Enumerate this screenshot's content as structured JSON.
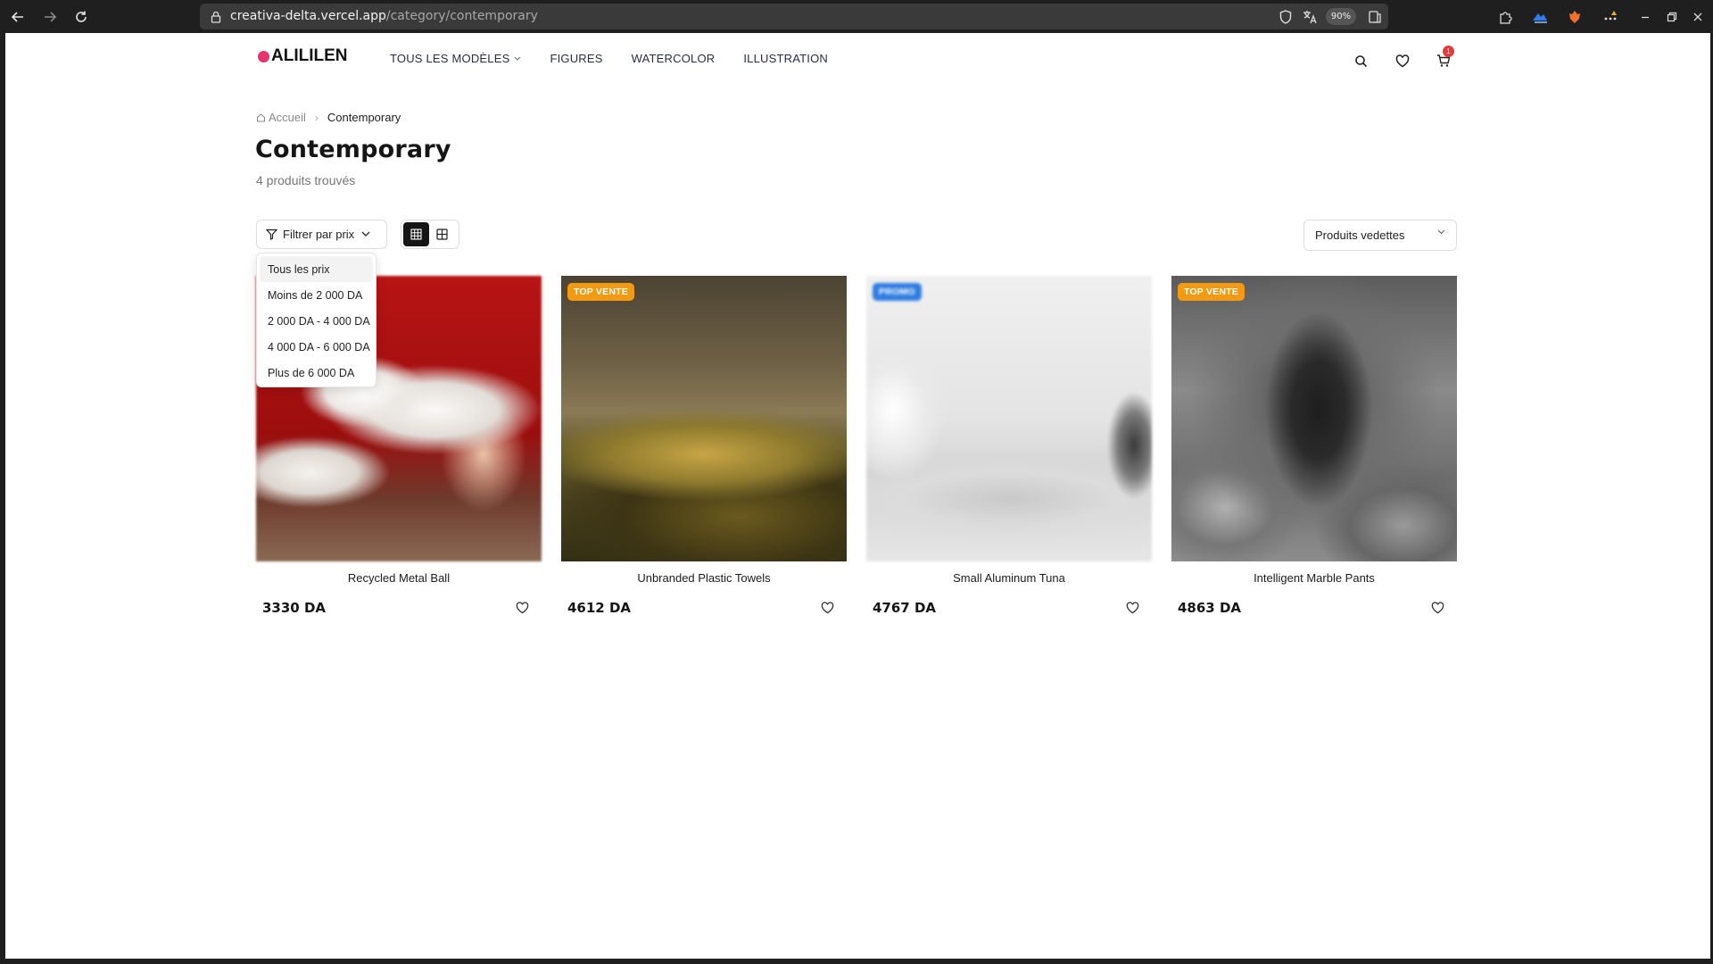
{
  "browser": {
    "url_host": "creativa-delta.vercel.app",
    "url_path": "/category/contemporary",
    "zoom": "90%"
  },
  "header": {
    "logo_text": "ALILILEN",
    "nav": [
      {
        "label": "TOUS LES MODÈLES",
        "has_dropdown": true
      },
      {
        "label": "FIGURES"
      },
      {
        "label": "WATERCOLOR"
      },
      {
        "label": "ILLUSTRATION"
      }
    ],
    "cart_count": "1"
  },
  "breadcrumb": {
    "home": "Accueil",
    "current": "Contemporary"
  },
  "page": {
    "title": "Contemporary",
    "count": "4 produits trouvés"
  },
  "toolbar": {
    "filter_label": "Filtrer par prix",
    "sort_label": "Produits vedettes"
  },
  "price_filter": {
    "options": [
      "Tous les prix",
      "Moins de 2 000 DA",
      "2 000 DA - 4 000 DA",
      "4 000 DA - 6 000 DA",
      "Plus de 6 000 DA"
    ],
    "selected": "Tous les prix"
  },
  "products": [
    {
      "name": "Recycled Metal Ball",
      "price": "3330 DA",
      "badge": "",
      "image": "white shoes"
    },
    {
      "name": "Unbranded Plastic Towels",
      "price": "4612 DA",
      "badge": "TOP VENTE",
      "badge_color": "#f29a12",
      "image": "landscape"
    },
    {
      "name": "Small Aluminum Tuna",
      "price": "4767 DA",
      "badge": "PROMO",
      "badge_color": "#2f7de1",
      "image": "desk laptop"
    },
    {
      "name": "Intelligent Marble Pants",
      "price": "4863 DA",
      "badge": "TOP VENTE",
      "badge_color": "#f29a12",
      "image": "rock arch"
    }
  ],
  "colors": {
    "logo_dot": "#e8336d",
    "badge_orange": "#f29a12",
    "badge_blue": "#2f7de1",
    "cart_badge": "#e23b3b"
  }
}
